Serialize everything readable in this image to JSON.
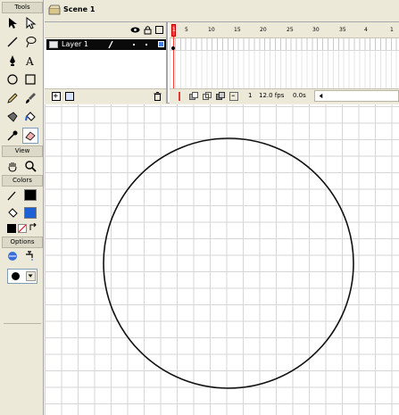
{
  "tools_panel": {
    "title": "Tools",
    "tools": [
      {
        "name": "arrow-tool"
      },
      {
        "name": "subselect-tool"
      },
      {
        "name": "line-tool"
      },
      {
        "name": "lasso-tool"
      },
      {
        "name": "pen-tool"
      },
      {
        "name": "text-tool"
      },
      {
        "name": "oval-tool"
      },
      {
        "name": "rectangle-tool"
      },
      {
        "name": "pencil-tool"
      },
      {
        "name": "brush-tool"
      },
      {
        "name": "ink-bottle-tool"
      },
      {
        "name": "paint-bucket-tool"
      },
      {
        "name": "eyedropper-tool"
      },
      {
        "name": "eraser-tool"
      }
    ],
    "view_label": "View",
    "view_tools": [
      {
        "name": "hand-tool"
      },
      {
        "name": "zoom-tool"
      }
    ],
    "colors_label": "Colors",
    "stroke_color": "#000000",
    "fill_color": "#1f5fd6",
    "options_label": "Options"
  },
  "scene": {
    "name": "Scene 1"
  },
  "timeline": {
    "layer_name": "Layer 1",
    "frame_numbers": [
      "1",
      "5",
      "10",
      "15",
      "20",
      "25",
      "30",
      "35",
      "4"
    ],
    "current_frame": "1",
    "frame_rate": "12.0 fps",
    "elapsed": "0.0s"
  },
  "stage": {
    "shape": "circle",
    "stroke": "#111111"
  },
  "colors": {
    "panel_bg": "#ece9d8",
    "playhead": "#ff3b3b",
    "layer_highlight": "#0a0a0a"
  }
}
